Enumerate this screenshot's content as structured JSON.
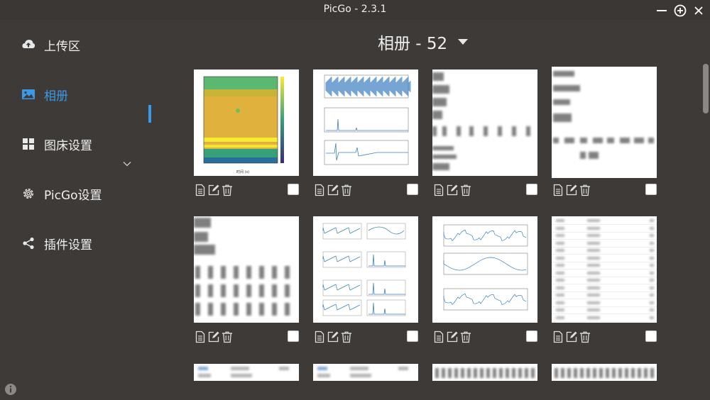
{
  "window": {
    "title": "PicGo - 2.3.1"
  },
  "sidebar": {
    "items": [
      {
        "label": "上传区",
        "icon": "cloud-upload-icon",
        "active": false
      },
      {
        "label": "相册",
        "icon": "image-icon",
        "active": true
      },
      {
        "label": "图床设置",
        "icon": "grid-icon",
        "active": false
      },
      {
        "label": "PicGo设置",
        "icon": "gear-icon",
        "active": false
      },
      {
        "label": "插件设置",
        "icon": "share-icon",
        "active": false
      }
    ]
  },
  "album": {
    "title": "相册 - 52"
  },
  "colors": {
    "accent": "#3b9ae8",
    "background": "#3d3a37"
  },
  "images": [
    {
      "kind": "heatmap-spectrogram"
    },
    {
      "kind": "waveform-fft-plots"
    },
    {
      "kind": "text-document-blurred"
    },
    {
      "kind": "text-document-blurred"
    },
    {
      "kind": "text-document-blurred"
    },
    {
      "kind": "multi-panel-signal-plots"
    },
    {
      "kind": "line-plots-three-panels"
    },
    {
      "kind": "table-list"
    },
    {
      "kind": "table-list-partial"
    },
    {
      "kind": "table-list-partial"
    },
    {
      "kind": "text-document-partial"
    },
    {
      "kind": "text-document-partial"
    }
  ]
}
